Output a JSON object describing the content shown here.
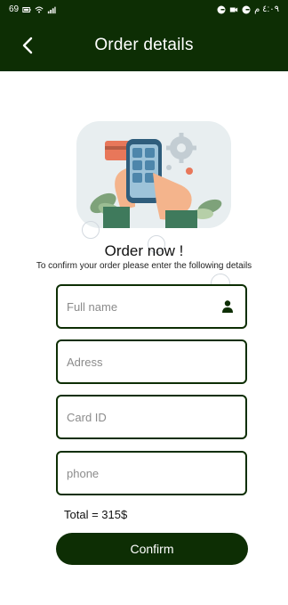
{
  "status_bar": {
    "left_text": "69",
    "right_text": "٤:٠٩ م"
  },
  "header": {
    "title": "Order details",
    "back_icon": "chevron-left-icon"
  },
  "hero": {
    "illustration": "phone-shopping-illustration"
  },
  "content": {
    "heading": "Order now !",
    "subheading": "To confirm your order please enter the following details"
  },
  "form": {
    "full_name_placeholder": "Full name",
    "address_placeholder": "Adress",
    "card_id_placeholder": "Card ID",
    "phone_placeholder": "phone",
    "person_icon": "person-icon"
  },
  "total": "Total = 315$",
  "confirm_label": "Confirm",
  "colors": {
    "primary": "#0d2e04",
    "text": "#222222",
    "placeholder": "#8b8b8b"
  }
}
